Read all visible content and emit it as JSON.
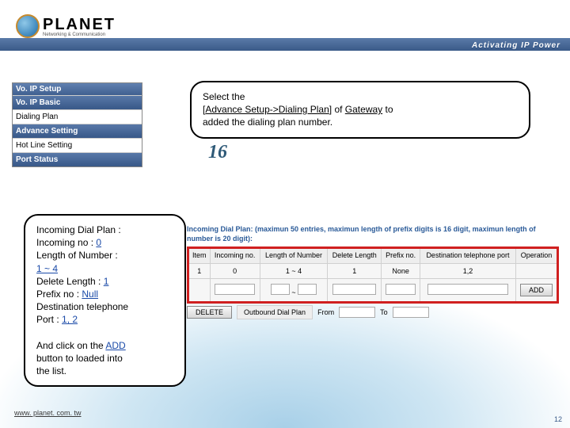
{
  "header": {
    "brand": "PLANET",
    "brand_sub": "Networking & Communication",
    "slogan": "Activating IP Power"
  },
  "nav": {
    "title": "Vo. IP Setup",
    "items": [
      {
        "label": "Vo. IP Basic",
        "style": "dark"
      },
      {
        "label": "Dialing Plan",
        "style": "white"
      },
      {
        "label": "Advance Setting",
        "style": "dark"
      },
      {
        "label": "Hot Line Setting",
        "style": "white"
      },
      {
        "label": "Port Status",
        "style": "dark"
      }
    ]
  },
  "callout_top": {
    "line1": "Select the",
    "line2a": "[",
    "line2b": "Advance Setup->Dialing Plan",
    "line2c": "] of ",
    "line2d": "Gateway",
    "line2e": " to",
    "line3": "added the dialing plan number."
  },
  "step_number": "16",
  "callout_left": {
    "l1": "Incoming Dial Plan :",
    "l2a": "Incoming no : ",
    "l2b": "0",
    "l3": "Length of Number :",
    "l4a": "1 ~ 4",
    "l5a": "Delete Length : ",
    "l5b": "1",
    "l6a": "Prefix no : ",
    "l6b": "Null",
    "l7": "Destination telephone",
    "l8a": "Port : ",
    "l8b": "1, 2",
    "l9a": "And click on the ",
    "l9b": "ADD",
    "l10": "button to loaded into",
    "l11": "the list."
  },
  "table": {
    "caption": "Incoming Dial Plan: (maximun 50 entries, maximun length of prefix digits is 16 digit, maximun length of number is 20 digit):",
    "headers": [
      "Item",
      "Incoming no.",
      "Length of Number",
      "Delete Length",
      "Prefix no.",
      "Destination telephone port",
      "Operation"
    ],
    "row": {
      "item": "1",
      "incoming": "0",
      "length": "1 ~ 4",
      "delete": "1",
      "prefix": "None",
      "dest": "1,2"
    },
    "tilde": "~",
    "add_label": "ADD",
    "delete_label": "DELETE",
    "outbound_label": "Outbound Dial Plan",
    "from_label": "From",
    "to_label": "To"
  },
  "footer": {
    "url": "www. planet. com. tw",
    "page": "12"
  }
}
